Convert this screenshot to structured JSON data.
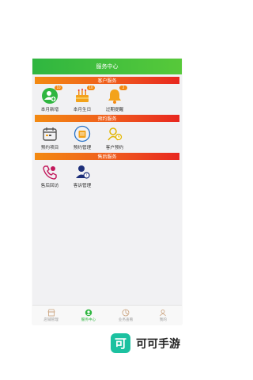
{
  "header": {
    "title": "服务中心"
  },
  "sections": [
    {
      "title": "客户服务",
      "items": [
        {
          "label": "本月新增",
          "badge": "10",
          "icon": "add-customer-icon"
        },
        {
          "label": "本月生日",
          "badge": "10",
          "icon": "birthday-cake-icon"
        },
        {
          "label": "过期提醒",
          "badge": "2",
          "icon": "bell-icon"
        }
      ]
    },
    {
      "title": "预约服务",
      "items": [
        {
          "label": "预约项目",
          "icon": "calendar-icon"
        },
        {
          "label": "预约管理",
          "icon": "appointment-management-icon"
        },
        {
          "label": "客户预约",
          "icon": "customer-appointment-icon"
        }
      ]
    },
    {
      "title": "售后服务",
      "items": [
        {
          "label": "售后回访",
          "icon": "phone-callback-icon"
        },
        {
          "label": "客诉管理",
          "icon": "complaint-user-icon"
        }
      ]
    }
  ],
  "tabbar": [
    {
      "label": "店铺管理",
      "icon": "shop-icon",
      "active": false
    },
    {
      "label": "服务中心",
      "icon": "service-center-icon",
      "active": true
    },
    {
      "label": "业务查看",
      "icon": "chart-pie-icon",
      "active": false
    },
    {
      "label": "我的",
      "icon": "profile-icon",
      "active": false
    }
  ],
  "watermark": {
    "logo_char": "可",
    "text": "可可手游"
  },
  "colors": {
    "green": "#2fb640",
    "orange": "#f38a12",
    "red": "#e8271f",
    "teal": "#1cc1a0"
  }
}
